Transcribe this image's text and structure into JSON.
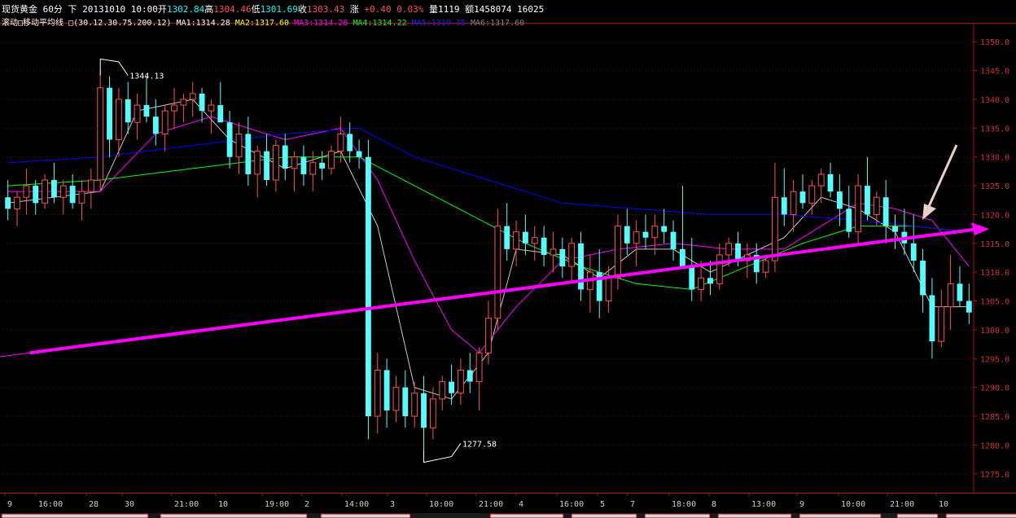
{
  "header": {
    "instrument": "现货黄金",
    "period": "60分",
    "nav": "下",
    "date": "20131010 10:00",
    "open_label": "开",
    "open": "1302.84",
    "high_label": "高",
    "high": "1304.46",
    "low_label": "低",
    "low": "1301.69",
    "close_label": "收",
    "close": "1303.43",
    "change_label": "涨",
    "change": "+0.40",
    "change_pct": "0.03%",
    "volume_label": "量",
    "volume": "1119",
    "amount_label": "额",
    "amount": "1458074",
    "extra": "16025"
  },
  "indicator": {
    "prefix": "滚动",
    "name": "移动平均线",
    "params": "(30.12.30.75.200.12)",
    "ma": [
      {
        "label": "MA1:",
        "value": "1314.28",
        "color": "#ffffff"
      },
      {
        "label": "MA2:",
        "value": "1317.60",
        "color": "#ffff00"
      },
      {
        "label": "MA3:",
        "value": "1314.28",
        "color": "#ff00ff"
      },
      {
        "label": "MA4:",
        "value": "1314.22",
        "color": "#00ff00"
      },
      {
        "label": "MA5:",
        "value": "1319.35",
        "color": "#0000ff"
      },
      {
        "label": "MA6:",
        "value": "1317.60",
        "color": "#808080"
      }
    ]
  },
  "chart_data": {
    "type": "candlestick",
    "ylim": [
      1272,
      1353
    ],
    "y_ticks": [
      "1350.0",
      "1345.0",
      "1340.0",
      "1335.0",
      "1330.0",
      "1325.0",
      "1320.0",
      "1315.0",
      "1310.0",
      "1305.0",
      "1300.0",
      "1295.0",
      "1290.0",
      "1285.0",
      "1280.0",
      "1275.0"
    ],
    "x_ticks": [
      "9",
      "16:00",
      "28",
      "30",
      "21:00",
      "10",
      "19:00",
      "2",
      "14:00",
      "3",
      "10:00",
      "21:00",
      "4",
      "16:00",
      "5",
      "7",
      "18:00",
      "8",
      "13:00",
      "9",
      "10:00",
      "21:00",
      "10"
    ],
    "annotations": [
      {
        "text": "1344.13",
        "type": "high"
      },
      {
        "text": "1277.58",
        "type": "low"
      }
    ],
    "candles": [
      [
        1323,
        1326,
        1319,
        1321
      ],
      [
        1321,
        1324,
        1318,
        1323
      ],
      [
        1323,
        1328,
        1320,
        1325
      ],
      [
        1325,
        1326,
        1320,
        1322
      ],
      [
        1322,
        1327,
        1321,
        1326
      ],
      [
        1326,
        1329,
        1322,
        1323
      ],
      [
        1323,
        1326,
        1320,
        1325
      ],
      [
        1325,
        1327,
        1321,
        1322
      ],
      [
        1322,
        1326,
        1319,
        1324
      ],
      [
        1324,
        1328,
        1321,
        1326
      ],
      [
        1326,
        1345,
        1324,
        1342
      ],
      [
        1342,
        1344,
        1330,
        1333
      ],
      [
        1333,
        1342,
        1330,
        1340
      ],
      [
        1340,
        1343,
        1334,
        1336
      ],
      [
        1336,
        1341,
        1333,
        1339
      ],
      [
        1339,
        1344,
        1336,
        1337
      ],
      [
        1337,
        1340,
        1332,
        1334
      ],
      [
        1334,
        1339,
        1331,
        1338
      ],
      [
        1338,
        1342,
        1335,
        1339
      ],
      [
        1339,
        1341,
        1336,
        1340
      ],
      [
        1340,
        1343,
        1337,
        1341
      ],
      [
        1341,
        1342,
        1336,
        1338
      ],
      [
        1338,
        1340,
        1334,
        1339
      ],
      [
        1339,
        1343,
        1336,
        1336
      ],
      [
        1336,
        1338,
        1328,
        1330
      ],
      [
        1330,
        1336,
        1327,
        1334
      ],
      [
        1334,
        1337,
        1325,
        1327
      ],
      [
        1327,
        1332,
        1323,
        1331
      ],
      [
        1331,
        1334,
        1325,
        1326
      ],
      [
        1326,
        1333,
        1324,
        1332
      ],
      [
        1332,
        1334,
        1326,
        1328
      ],
      [
        1328,
        1331,
        1324,
        1330
      ],
      [
        1330,
        1332,
        1325,
        1327
      ],
      [
        1327,
        1331,
        1324,
        1329
      ],
      [
        1329,
        1331,
        1326,
        1328
      ],
      [
        1328,
        1332,
        1327,
        1331
      ],
      [
        1331,
        1337,
        1329,
        1334
      ],
      [
        1334,
        1336,
        1329,
        1331
      ],
      [
        1331,
        1333,
        1328,
        1330
      ],
      [
        1330,
        1333,
        1281,
        1285
      ],
      [
        1285,
        1296,
        1282,
        1293
      ],
      [
        1293,
        1295,
        1283,
        1286
      ],
      [
        1286,
        1292,
        1284,
        1290
      ],
      [
        1290,
        1293,
        1283,
        1285
      ],
      [
        1285,
        1291,
        1283,
        1289
      ],
      [
        1289,
        1292,
        1277.58,
        1283
      ],
      [
        1283,
        1290,
        1281,
        1288
      ],
      [
        1288,
        1292,
        1286,
        1291
      ],
      [
        1291,
        1294,
        1287,
        1289
      ],
      [
        1289,
        1295,
        1287,
        1293
      ],
      [
        1293,
        1296,
        1289,
        1291
      ],
      [
        1291,
        1297,
        1286,
        1296
      ],
      [
        1296,
        1305,
        1294,
        1302
      ],
      [
        1302,
        1321,
        1300,
        1318
      ],
      [
        1318,
        1322,
        1312,
        1314
      ],
      [
        1314,
        1319,
        1311,
        1317
      ],
      [
        1317,
        1320,
        1313,
        1315
      ],
      [
        1315,
        1318,
        1312,
        1316
      ],
      [
        1316,
        1318,
        1311,
        1313
      ],
      [
        1313,
        1317,
        1310,
        1314
      ],
      [
        1314,
        1316,
        1309,
        1311
      ],
      [
        1311,
        1316,
        1308,
        1315
      ],
      [
        1315,
        1317,
        1305,
        1307
      ],
      [
        1307,
        1313,
        1303,
        1310
      ],
      [
        1310,
        1314,
        1302,
        1305
      ],
      [
        1305,
        1311,
        1303,
        1309
      ],
      [
        1309,
        1320,
        1307,
        1318
      ],
      [
        1318,
        1321,
        1313,
        1315
      ],
      [
        1315,
        1319,
        1311,
        1317
      ],
      [
        1317,
        1320,
        1314,
        1316
      ],
      [
        1316,
        1320,
        1313,
        1318
      ],
      [
        1318,
        1321,
        1315,
        1317
      ],
      [
        1317,
        1319,
        1312,
        1314
      ],
      [
        1314,
        1325,
        1311,
        1311
      ],
      [
        1311,
        1316,
        1305,
        1307
      ],
      [
        1307,
        1312,
        1305,
        1309
      ],
      [
        1309,
        1312,
        1306,
        1308
      ],
      [
        1308,
        1315,
        1307,
        1313
      ],
      [
        1313,
        1316,
        1311,
        1315
      ],
      [
        1315,
        1317,
        1311,
        1312
      ],
      [
        1312,
        1315,
        1309,
        1313
      ],
      [
        1313,
        1315,
        1308,
        1310
      ],
      [
        1310,
        1313,
        1309,
        1312
      ],
      [
        1312,
        1329,
        1310,
        1323
      ],
      [
        1323,
        1328,
        1318,
        1320
      ],
      [
        1320,
        1326,
        1317,
        1324
      ],
      [
        1324,
        1327,
        1321,
        1322
      ],
      [
        1322,
        1326,
        1320,
        1325
      ],
      [
        1325,
        1328,
        1322,
        1327
      ],
      [
        1327,
        1329,
        1323,
        1324
      ],
      [
        1324,
        1327,
        1318,
        1321
      ],
      [
        1321,
        1325,
        1316,
        1317
      ],
      [
        1317,
        1327,
        1315,
        1325
      ],
      [
        1325,
        1330,
        1319,
        1320
      ],
      [
        1320,
        1324,
        1318,
        1323
      ],
      [
        1323,
        1326,
        1315,
        1318
      ],
      [
        1318,
        1320,
        1314,
        1317
      ],
      [
        1317,
        1321,
        1313,
        1315
      ],
      [
        1315,
        1320,
        1310,
        1312
      ],
      [
        1312,
        1314,
        1303,
        1306
      ],
      [
        1306,
        1309,
        1295,
        1298
      ],
      [
        1298,
        1307,
        1297,
        1304
      ],
      [
        1304,
        1313,
        1300,
        1308
      ],
      [
        1308,
        1311,
        1304,
        1305
      ],
      [
        1305,
        1308,
        1301,
        1303
      ]
    ],
    "ma_lines": [
      {
        "name": "MA1",
        "color": "#c8c8c8",
        "points": [
          [
            0,
            1322
          ],
          [
            10,
            1324
          ],
          [
            14,
            1338
          ],
          [
            20,
            1340
          ],
          [
            24,
            1333
          ],
          [
            30,
            1328
          ],
          [
            36,
            1331
          ],
          [
            40,
            1318
          ],
          [
            44,
            1290
          ],
          [
            48,
            1288
          ],
          [
            52,
            1296
          ],
          [
            55,
            1314
          ],
          [
            60,
            1313
          ],
          [
            64,
            1309
          ],
          [
            68,
            1314
          ],
          [
            72,
            1314
          ],
          [
            76,
            1310
          ],
          [
            80,
            1313
          ],
          [
            84,
            1316
          ],
          [
            88,
            1323
          ],
          [
            92,
            1321
          ],
          [
            96,
            1317
          ],
          [
            100,
            1304
          ],
          [
            104,
            1304
          ]
        ]
      },
      {
        "name": "MA3",
        "color": "#ff00ff",
        "points": [
          [
            0,
            1324
          ],
          [
            10,
            1324
          ],
          [
            16,
            1334
          ],
          [
            22,
            1337
          ],
          [
            30,
            1333
          ],
          [
            36,
            1335
          ],
          [
            40,
            1326
          ],
          [
            44,
            1312
          ],
          [
            48,
            1300
          ],
          [
            51,
            1296
          ],
          [
            55,
            1304
          ],
          [
            60,
            1312
          ],
          [
            66,
            1314
          ],
          [
            72,
            1315
          ],
          [
            78,
            1314
          ],
          [
            84,
            1314
          ],
          [
            88,
            1318
          ],
          [
            92,
            1322
          ],
          [
            96,
            1321
          ],
          [
            100,
            1319
          ],
          [
            104,
            1311
          ]
        ]
      },
      {
        "name": "MA4",
        "color": "#00ff00",
        "points": [
          [
            0,
            1325
          ],
          [
            10,
            1326
          ],
          [
            20,
            1328
          ],
          [
            30,
            1330
          ],
          [
            38,
            1330
          ],
          [
            44,
            1325
          ],
          [
            50,
            1320
          ],
          [
            56,
            1315
          ],
          [
            62,
            1311
          ],
          [
            68,
            1308
          ],
          [
            74,
            1307
          ],
          [
            80,
            1311
          ],
          [
            86,
            1315
          ],
          [
            92,
            1318
          ],
          [
            98,
            1318
          ],
          [
            104,
            1317
          ]
        ]
      },
      {
        "name": "MA5",
        "color": "#0000ff",
        "points": [
          [
            0,
            1329
          ],
          [
            10,
            1330
          ],
          [
            20,
            1332
          ],
          [
            30,
            1334
          ],
          [
            38,
            1335
          ],
          [
            44,
            1330
          ],
          [
            52,
            1326
          ],
          [
            60,
            1322
          ],
          [
            68,
            1321
          ],
          [
            76,
            1320
          ],
          [
            84,
            1320
          ],
          [
            92,
            1319
          ],
          [
            98,
            1318
          ],
          [
            104,
            1317
          ]
        ]
      }
    ],
    "trendline": {
      "color": "#ff00ff",
      "points": [
        [
          -41,
          1287
        ],
        [
          106,
          1317.5
        ]
      ]
    },
    "annotation_arrow": {
      "color": "#e8d0c8"
    }
  },
  "bottom_tabs": [
    "",
    "",
    "",
    "",
    "",
    "",
    "",
    "",
    "",
    "",
    "",
    "",
    ""
  ]
}
